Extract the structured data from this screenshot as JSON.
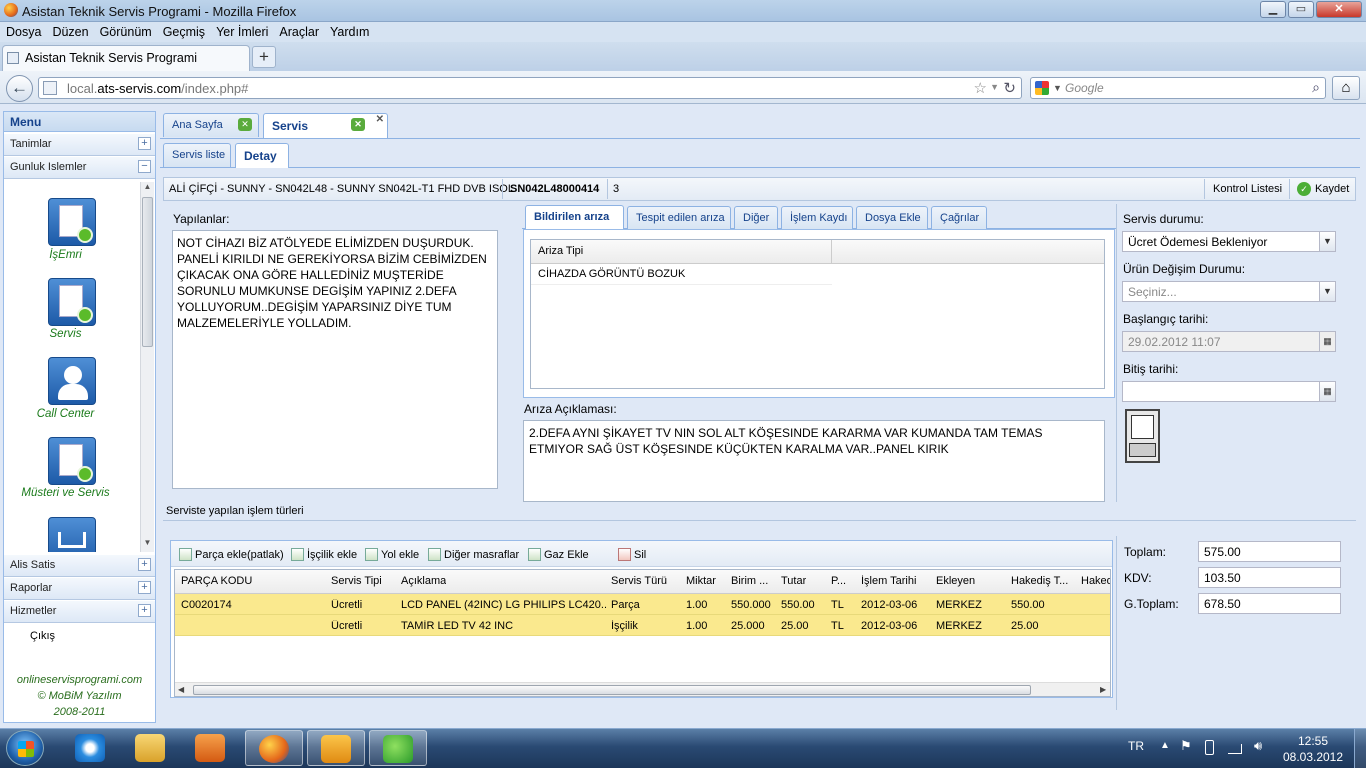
{
  "window": {
    "title": "Asistan Teknik Servis Programi - Mozilla Firefox",
    "btn_min": "▁",
    "btn_max": "▭",
    "btn_close": "✕"
  },
  "menubar": [
    "Dosya",
    "Düzen",
    "Görünüm",
    "Geçmiş",
    "Yer İmleri",
    "Araçlar",
    "Yardım"
  ],
  "browser_tab": {
    "label": "Asistan Teknik Servis Programi",
    "new_tab": "+"
  },
  "address": {
    "url_prefix": "local.",
    "url_domain": "ats-servis.com",
    "url_suffix": "/index.php#",
    "search_placeholder": "Google"
  },
  "sidebar": {
    "title": "Menu",
    "sections_top": [
      {
        "label": "Tanimlar",
        "toggle": "+"
      },
      {
        "label": "Gunluk Islemler",
        "toggle": "−"
      }
    ],
    "icons": [
      {
        "label": "İşEmri",
        "icon": "work-order-icon"
      },
      {
        "label": "Servis",
        "icon": "service-icon"
      },
      {
        "label": "Call Center",
        "icon": "call-center-icon"
      },
      {
        "label": "Müsteri ve Servis",
        "icon": "customer-service-icon"
      }
    ],
    "sections_bottom": [
      {
        "label": "Alis Satis",
        "toggle": "+"
      },
      {
        "label": "Raporlar",
        "toggle": "+"
      },
      {
        "label": "Hizmetler",
        "toggle": "+"
      }
    ],
    "exit": "Çıkış",
    "footer": [
      "onlineservisprogrami.com",
      "© MoBiM Yazılım",
      "2008-2011"
    ]
  },
  "main_tabs": [
    {
      "label": "Ana Sayfa"
    },
    {
      "label": "Servis"
    }
  ],
  "sub_tabs": [
    {
      "label": "Servis liste"
    },
    {
      "label": "Detay"
    }
  ],
  "record": {
    "title": "ALİ ÇİFÇİ - SUNNY - SN042L48 - SUNNY SN042L-T1 FHD DVB ISOL",
    "serial": "SN042L48000414",
    "count": "3",
    "check_list": "Kontrol Listesi",
    "save": "Kaydet"
  },
  "yapilanlar": {
    "label": "Yapılanlar:",
    "text": "NOT CİHAZI BİZ ATÖLYEDE ELİMİZDEN DUŞURDUK. PANELİ KIRILDI NE GEREKİYORSA BİZİM CEBİMİZDEN ÇIKACAK ONA GÖRE HALLEDİNİZ MUŞTERİDE SORUNLU MUMKUNSE DEGİŞİM YAPINIZ 2.DEFA YOLLUYORUM..DEGİŞİM YAPARSINIZ DİYE TUM MALZEMELERİYLE YOLLADIM."
  },
  "fault_tabs": [
    "Bildirilen arıza",
    "Tespit edilen arıza",
    "Diğer",
    "İşlem Kaydı",
    "Dosya Ekle",
    "Çağrılar"
  ],
  "fault_grid": {
    "header": "Ariza Tipi",
    "rows": [
      "CİHAZDA GÖRÜNTÜ BOZUK"
    ]
  },
  "fault_desc": {
    "label": "Arıza Açıklaması:",
    "text": "2.DEFA AYNI ŞİKAYET TV NIN SOL ALT KÖŞESINDE KARARMA VAR KUMANDA TAM TEMAS ETMIYOR SAĞ ÜST KÖŞESINDE KÜÇÜKTEN KARALMA VAR..PANEL KIRIK"
  },
  "status": {
    "service_label": "Servis durumu:",
    "service_value": "Ücret Ödemesi Bekleniyor",
    "exchange_label": "Ürün Değişim Durumu:",
    "exchange_placeholder": "Seçiniz...",
    "start_label": "Başlangıç tarihi:",
    "start_value": "29.02.2012 11:07",
    "end_label": "Bitiş tarihi:",
    "end_value": ""
  },
  "ops": {
    "title": "Serviste yapılan işlem türleri",
    "toolbar": [
      "Parça ekle(patlak)",
      "İşçilik ekle",
      "Yol ekle",
      "Diğer masraflar",
      "Gaz Ekle",
      "Sil"
    ],
    "columns": [
      "PARÇA KODU",
      "Servis Tipi",
      "Açıklama",
      "Servis Türü",
      "Miktar",
      "Birim ...",
      "Tutar",
      "P...",
      "İşlem Tarihi",
      "Ekleyen",
      "Hakediş T...",
      "Haked"
    ],
    "rows": [
      [
        "C0020174",
        "Ücretli",
        "LCD PANEL (42INC) LG PHILIPS LC420...",
        "Parça",
        "1.00",
        "550.000",
        "550.00",
        "TL",
        "2012-03-06",
        "MERKEZ",
        "550.00",
        ""
      ],
      [
        "",
        "Ücretli",
        "TAMİR LED TV 42 INC",
        "İşçilik",
        "1.00",
        "25.000",
        "25.00",
        "TL",
        "2012-03-06",
        "MERKEZ",
        "25.00",
        ""
      ]
    ]
  },
  "totals": {
    "toplam_label": "Toplam:",
    "toplam": "575.00",
    "kdv_label": "KDV:",
    "kdv": "103.50",
    "gtoplam_label": "G.Toplam:",
    "gtoplam": "678.50"
  },
  "taskbar": {
    "lang": "TR",
    "time": "12:55",
    "date": "08.03.2012"
  }
}
